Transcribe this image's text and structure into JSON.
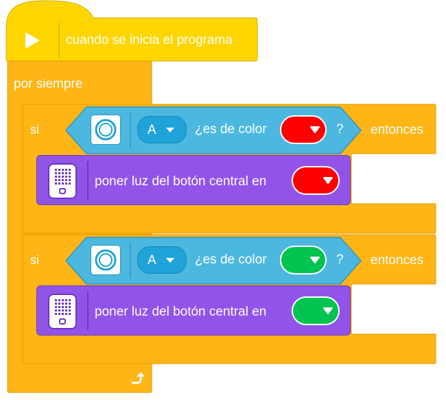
{
  "event_block": {
    "label": "cuando se inicia el programa",
    "icon": "play-icon",
    "color": "#FFD500"
  },
  "forever_block": {
    "label": "por siempre",
    "loop_icon": "loop-arrow-icon",
    "color": "#FFB515"
  },
  "if_blocks": [
    {
      "if_label": "si",
      "then_label": "entonces",
      "condition": {
        "sensor_icon": "color-sensor-icon",
        "port": "A",
        "question": "¿es de color",
        "color_value": "#FF0000",
        "question_mark": "?"
      },
      "action": {
        "icon": "hub-icon",
        "label": "poner luz del botón central en",
        "color_value": "#FF0000"
      }
    },
    {
      "if_label": "si",
      "then_label": "entonces",
      "condition": {
        "sensor_icon": "color-sensor-icon",
        "port": "A",
        "question": "¿es de color",
        "color_value": "#00C44F",
        "question_mark": "?"
      },
      "action": {
        "icon": "hub-icon",
        "label": "poner luz del botón central en",
        "color_value": "#00C44F"
      }
    }
  ],
  "palette": {
    "event_yellow": "#FFD500",
    "control_orange": "#FFB515",
    "sensor_blue": "#4CB8E0",
    "light_purple": "#9254E8",
    "port_blue": "#1FA3D8"
  }
}
